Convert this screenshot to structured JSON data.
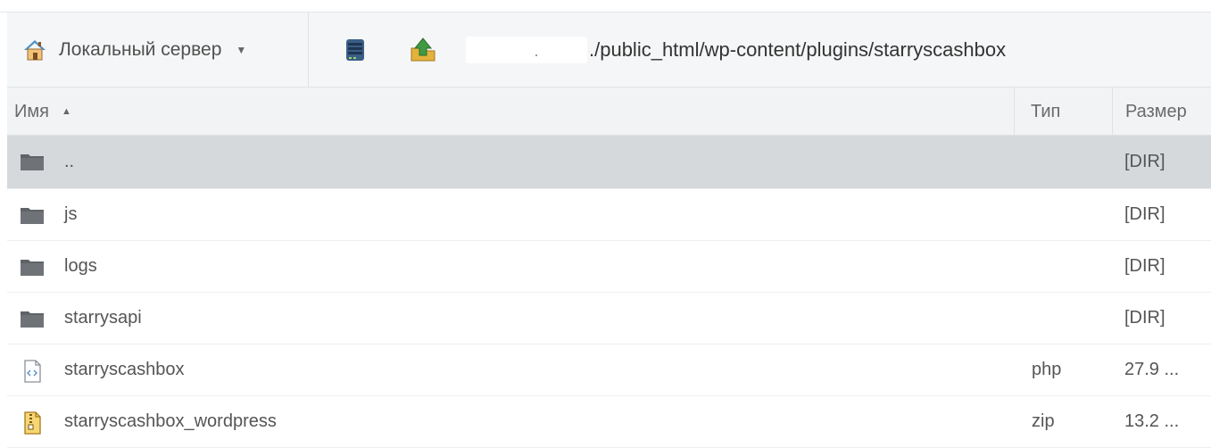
{
  "toolbar": {
    "server_label": "Локальный сервер",
    "server_icon": "house-icon",
    "caret_icon": "caret-down-icon",
    "drive_icon": "drive-icon",
    "upload_icon": "upload-folder-icon",
    "path": "./public_html/wp-content/plugins/starryscashbox"
  },
  "columns": {
    "name": "Имя",
    "type": "Тип",
    "size": "Размер"
  },
  "files": [
    {
      "name": "..",
      "type": "",
      "size": "[DIR]",
      "icon": "folder-icon",
      "selected": true
    },
    {
      "name": "js",
      "type": "",
      "size": "[DIR]",
      "icon": "folder-icon",
      "selected": false
    },
    {
      "name": "logs",
      "type": "",
      "size": "[DIR]",
      "icon": "folder-icon",
      "selected": false
    },
    {
      "name": "starrysapi",
      "type": "",
      "size": "[DIR]",
      "icon": "folder-icon",
      "selected": false
    },
    {
      "name": "starryscashbox",
      "type": "php",
      "size": "27.9 ...",
      "icon": "code-file-icon",
      "selected": false
    },
    {
      "name": "starryscashbox_wordpress",
      "type": "zip",
      "size": "13.2 ...",
      "icon": "zip-file-icon",
      "selected": false
    }
  ],
  "colors": {
    "selected_row": "#d6d9dc",
    "header_bg": "#f1f3f4",
    "folder": "#5f6368",
    "house_roof": "#4b8fc9",
    "upload_green": "#3f9a43",
    "zip_yellow": "#e3b23c"
  }
}
